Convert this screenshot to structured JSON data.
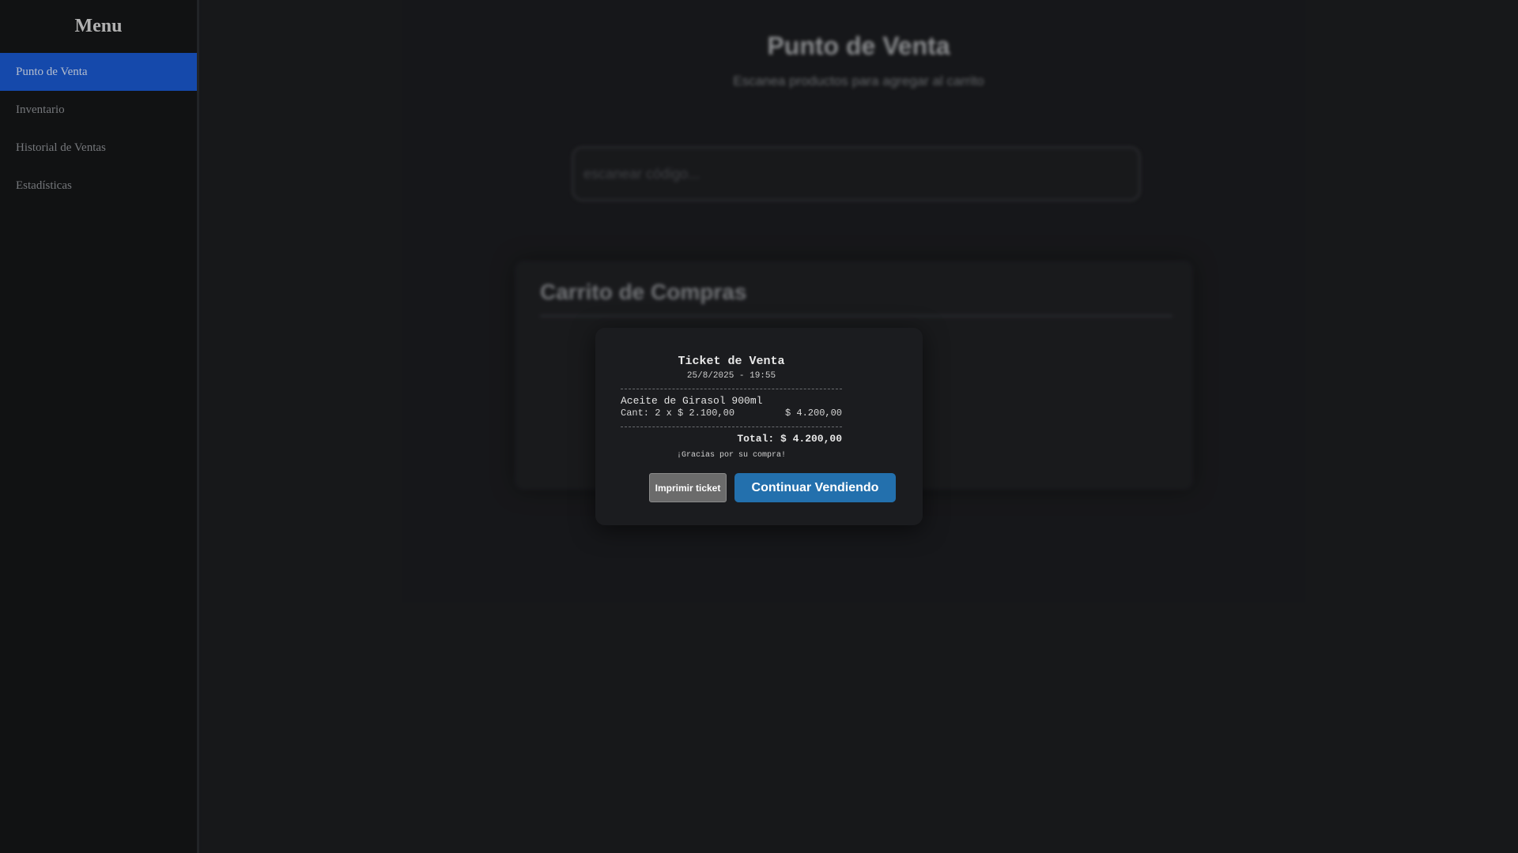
{
  "sidebar": {
    "title": "Menu",
    "items": [
      {
        "label": "Punto de Venta",
        "active": true
      },
      {
        "label": "Inventario",
        "active": false
      },
      {
        "label": "Historial de Ventas",
        "active": false
      },
      {
        "label": "Estadísticas",
        "active": false
      }
    ]
  },
  "main": {
    "title": "Punto de Venta",
    "subtitle": "Escanea productos para agregar al carrito",
    "scan_placeholder": "escanear código...",
    "cart_title": "Carrito de Compras"
  },
  "ticket": {
    "title": "Ticket de Venta",
    "datetime": "25/8/2025 - 19:55",
    "items": [
      {
        "name": "Aceite de Girasol 900ml",
        "qty_line": "Cant: 2 x $ 2.100,00",
        "subtotal": "$ 4.200,00"
      }
    ],
    "total": "Total: $ 4.200,00",
    "thanks": "¡Gracias por su compra!",
    "print_label": "Imprimir ticket",
    "continue_label": "Continuar Vendiendo"
  },
  "colors": {
    "accent_active": "#1a5ad1",
    "continue_button": "#2370ad",
    "print_button": "#6b6b6b",
    "background": "#1c1d20"
  }
}
